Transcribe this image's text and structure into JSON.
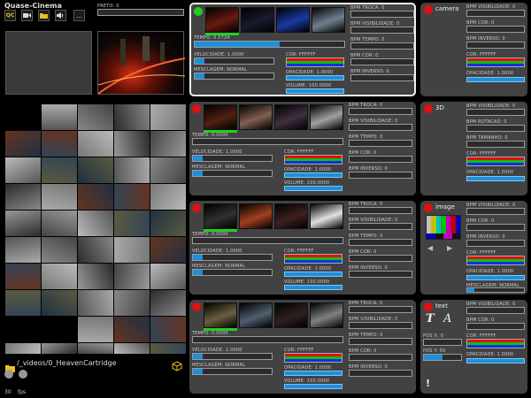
{
  "app": {
    "title": "Quase-Cinema",
    "preto_label": "PRETO: 0",
    "fps_value": "30",
    "fps_unit": "fps",
    "path": "/_videos/0_HeavenCartridge"
  },
  "toolbar": {
    "qc_label": "QC",
    "more_label": "..."
  },
  "layers": [
    {
      "active_color": "#22cc22",
      "tempo": "TEMPO: 0.5724",
      "tempo_fill": 0.57,
      "velocidade": "VELOCIDADE: 1.0000",
      "mesclagem": "MESCLAGEM: NORMAL",
      "cor": "COR: FFFFFF",
      "opacidade": "OPACIDADE: 1.0000",
      "volume": "VOLUME: 100.0000",
      "bpm_troca": "BPM TROCA: 0",
      "bpm_visibilidade": "BPM VISIBILIDADE: 0",
      "bpm_tempo": "BPM TEMPO: 0",
      "bpm_cor": "BPM COR: 0",
      "bpm_inverso": "BPM INVERSO: 0"
    },
    {
      "active_color": "#dd1111",
      "tempo": "TEMPO: 0.0000",
      "tempo_fill": 0,
      "velocidade": "VELOCIDADE: 1.0000",
      "mesclagem": "MESCLAGEM: NORMAL",
      "cor": "COR: FFFFFF",
      "opacidade": "OPACIDADE: 1.0000",
      "volume": "VOLUME: 100.0000",
      "bpm_troca": "BPM TROCA: 0",
      "bpm_visibilidade": "BPM VISIBILIDADE: 0",
      "bpm_tempo": "BPM TEMPO: 0",
      "bpm_cor": "BPM COR: 0",
      "bpm_inverso": "BPM INVERSO: 0"
    },
    {
      "active_color": "#dd1111",
      "tempo": "TEMPO: 0.0000",
      "tempo_fill": 0,
      "velocidade": "VELOCIDADE: 1.0000",
      "mesclagem": "MESCLAGEM: NORMAL",
      "cor": "COR: FFFFFF",
      "opacidade": "OPACIDADE: 1.0000",
      "volume": "VOLUME: 100.0000",
      "bpm_troca": "BPM TROCA: 0",
      "bpm_visibilidade": "BPM VISIBILIDADE: 0",
      "bpm_tempo": "BPM TEMPO: 0",
      "bpm_cor": "BPM COR: 0",
      "bpm_inverso": "BPM INVERSO: 0"
    },
    {
      "active_color": "#dd1111",
      "tempo": "TEMPO: 0.0000",
      "tempo_fill": 0,
      "velocidade": "VELOCIDADE: 1.0000",
      "mesclagem": "MESCLAGEM: NORMAL",
      "cor": "COR: FFFFFF",
      "opacidade": "OPACIDADE: 1.0000",
      "volume": "VOLUME: 100.0000",
      "bpm_troca": "BPM TROCA: 0",
      "bpm_visibilidade": "BPM VISIBILIDADE: 0",
      "bpm_tempo": "BPM TEMPO: 0",
      "bpm_cor": "BPM COR: 0",
      "bpm_inverso": "BPM INVERSO: 0"
    }
  ],
  "camera": {
    "title": "camera",
    "bpm_visibilidade": "BPM VISIBILIDADE: 0",
    "bpm_cor": "BPM COR: 0",
    "bpm_inverso": "BPM INVERSO: 0",
    "cor": "COR: FFFFFF",
    "opacidade": "OPACIDADE: 1.0000"
  },
  "three_d": {
    "title": "3D",
    "bpm_visibilidade": "BPM VISIBILIDADE: 0",
    "bpm_rotacao": "BPM ROTACAO: 0",
    "bpm_tamanho": "BPM TAMANHO: 0",
    "cor": "COR: FFFFFF",
    "opacidade": "OPACIDADE: 1.0000"
  },
  "image": {
    "title": "image",
    "bpm_visibilidade": "BPM VISIBILIDADE: 0",
    "bpm_cor": "BPM COR: 0",
    "bpm_inverso": "BPM INVERSO: 0",
    "cor": "COR: FFFFFF",
    "opacidade": "OPACIDADE: 1.0000",
    "mesclagem": "MESCLAGEM: NORMAL",
    "prev_arrow": "◀",
    "next_arrow": "▶"
  },
  "text": {
    "title": "text",
    "bpm_visibilidade": "BPM VISIBILIDADE: 0",
    "bpm_cor": "BPM COR: 0",
    "cor": "COR: FFFFFF",
    "opacidade": "OPACIDADE: 1.0000",
    "pos_x": "POS X: 0",
    "pos_y": "POS Y: 50",
    "glyph_t": "T",
    "glyph_a": "A",
    "alert": "!"
  },
  "colors": {
    "panel": "#424242",
    "accent_blue": "#1e8fd8",
    "active_green": "#22cc22",
    "inactive_red": "#dd1111"
  }
}
